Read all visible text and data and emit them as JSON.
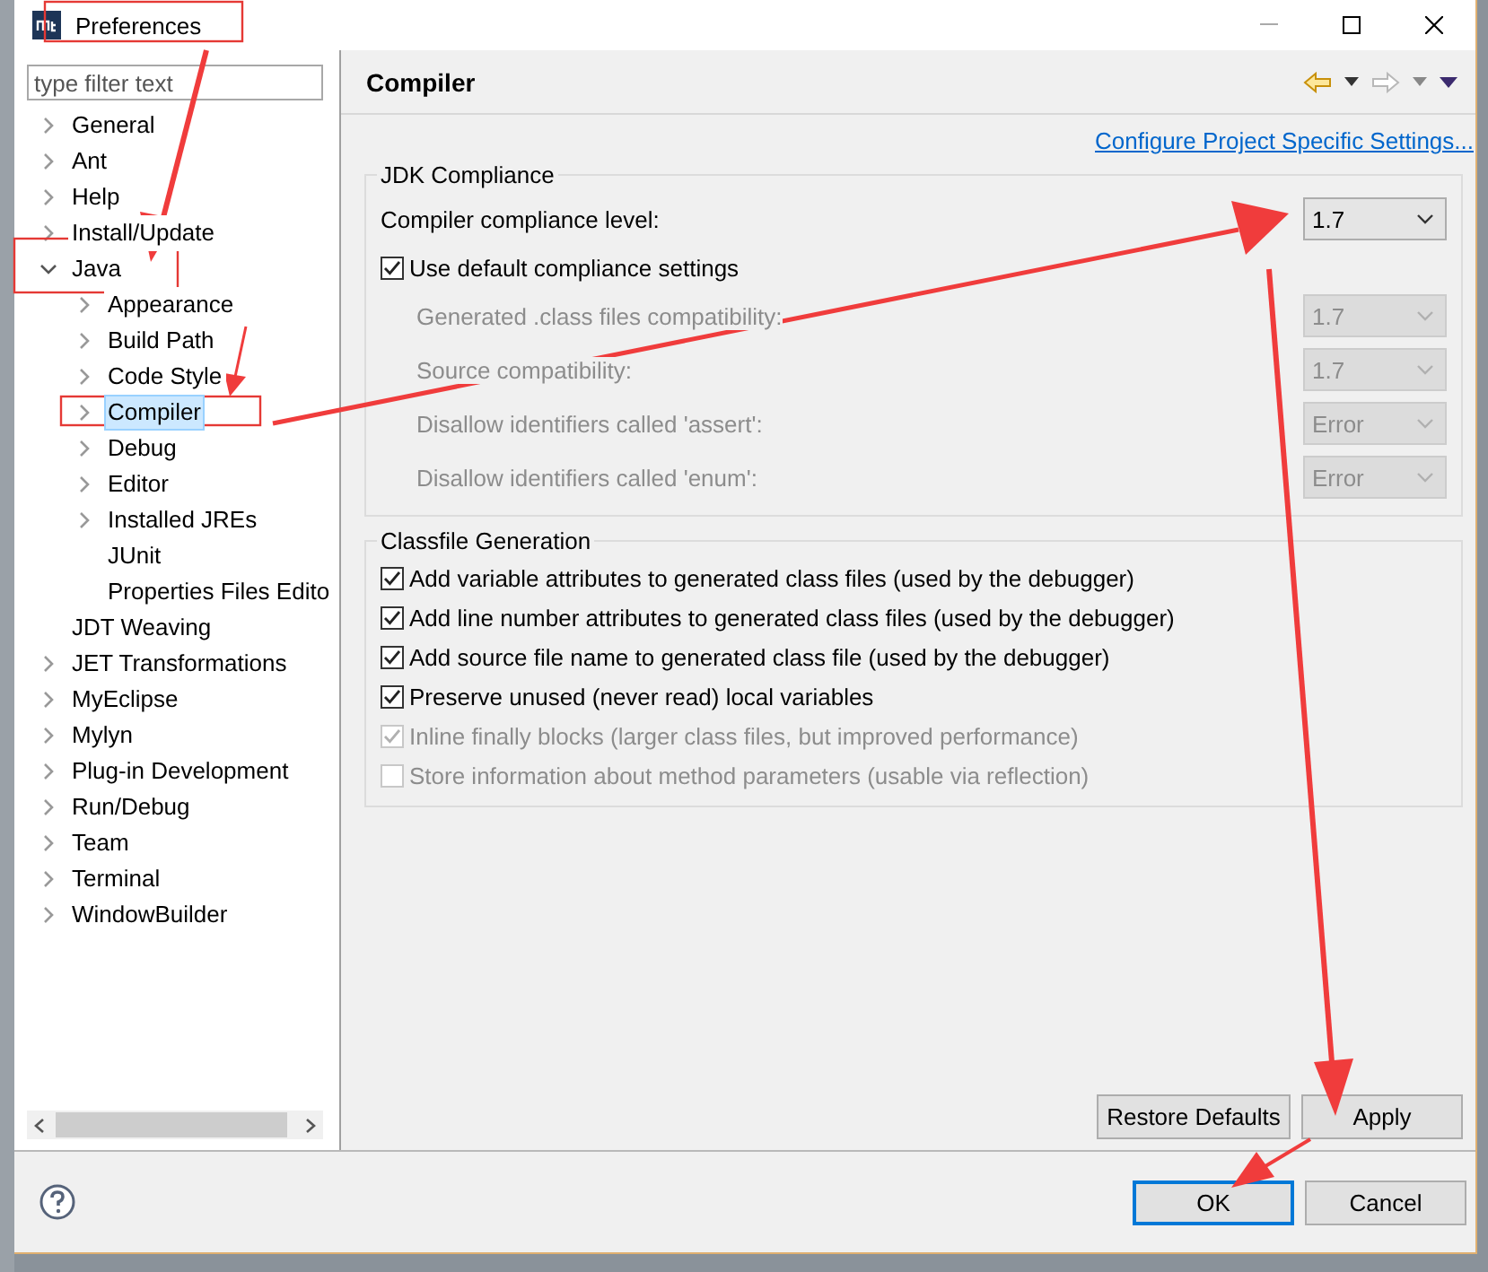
{
  "window": {
    "title": "Preferences"
  },
  "filter": {
    "placeholder": "type filter text"
  },
  "tree": [
    {
      "label": "General",
      "expanded": false,
      "selected": false
    },
    {
      "label": "Ant",
      "expanded": false,
      "selected": false
    },
    {
      "label": "Help",
      "expanded": false,
      "selected": false
    },
    {
      "label": "Install/Update",
      "expanded": false,
      "selected": false
    },
    {
      "label": "Java",
      "expanded": true,
      "selected": false,
      "children": [
        {
          "label": "Appearance",
          "expanded": false,
          "selected": false
        },
        {
          "label": "Build Path",
          "expanded": false,
          "selected": false
        },
        {
          "label": "Code Style",
          "expanded": false,
          "selected": false
        },
        {
          "label": "Compiler",
          "expanded": false,
          "selected": true
        },
        {
          "label": "Debug",
          "expanded": false,
          "selected": false
        },
        {
          "label": "Editor",
          "expanded": false,
          "selected": false
        },
        {
          "label": "Installed JREs",
          "expanded": false,
          "selected": false
        },
        {
          "label": "JUnit",
          "selected": false
        },
        {
          "label": "Properties Files Edito",
          "selected": false
        }
      ]
    },
    {
      "label": "JDT Weaving",
      "selected": false
    },
    {
      "label": "JET Transformations",
      "expanded": false,
      "selected": false
    },
    {
      "label": "MyEclipse",
      "expanded": false,
      "selected": false
    },
    {
      "label": "Mylyn",
      "expanded": false,
      "selected": false
    },
    {
      "label": "Plug-in Development",
      "expanded": false,
      "selected": false
    },
    {
      "label": "Run/Debug",
      "expanded": false,
      "selected": false
    },
    {
      "label": "Team",
      "expanded": false,
      "selected": false
    },
    {
      "label": "Terminal",
      "expanded": false,
      "selected": false
    },
    {
      "label": "WindowBuilder",
      "expanded": false,
      "selected": false
    }
  ],
  "page": {
    "title": "Compiler",
    "link": "Configure Project Specific Settings..."
  },
  "jdk_compliance": {
    "title": "JDK Compliance",
    "rows": [
      {
        "kind": "dropdown",
        "label": "Compiler compliance level:",
        "value": "1.7",
        "disabled": false
      },
      {
        "kind": "checkbox",
        "label": "Use default compliance settings",
        "checked": true,
        "disabled": false
      },
      {
        "kind": "dropdown",
        "label": "Generated .class files compatibility:",
        "value": "1.7",
        "disabled": true
      },
      {
        "kind": "dropdown",
        "label": "Source compatibility:",
        "value": "1.7",
        "disabled": true
      },
      {
        "kind": "dropdown",
        "label": "Disallow identifiers called 'assert':",
        "value": "Error",
        "disabled": true
      },
      {
        "kind": "dropdown",
        "label": "Disallow identifiers called 'enum':",
        "value": "Error",
        "disabled": true
      }
    ]
  },
  "classfile_generation": {
    "title": "Classfile Generation",
    "options": [
      {
        "label": "Add variable attributes to generated class files (used by the debugger)",
        "checked": true,
        "disabled": false
      },
      {
        "label": "Add line number attributes to generated class files (used by the debugger)",
        "checked": true,
        "disabled": false
      },
      {
        "label": "Add source file name to generated class file (used by the debugger)",
        "checked": true,
        "disabled": false
      },
      {
        "label": "Preserve unused (never read) local variables",
        "checked": true,
        "disabled": false
      },
      {
        "label": "Inline finally blocks (larger class files, but improved performance)",
        "checked": true,
        "disabled": true
      },
      {
        "label": "Store information about method parameters (usable via reflection)",
        "checked": false,
        "disabled": true
      }
    ]
  },
  "page_buttons": [
    "Restore Defaults",
    "Apply"
  ],
  "dialog_buttons": [
    {
      "label": "OK",
      "default": true
    },
    {
      "label": "Cancel",
      "default": false
    }
  ]
}
